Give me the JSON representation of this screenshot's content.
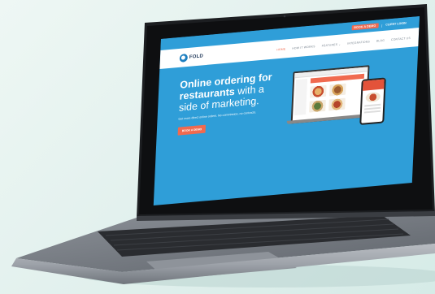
{
  "topbar": {
    "book_button": "BOOK A DEMO",
    "separator": "|",
    "login_link": "CLIENT LOGIN"
  },
  "navbar": {
    "logo_text": "FOLD",
    "links": [
      {
        "label": "HOME",
        "active": true
      },
      {
        "label": "HOW IT WORKS",
        "active": false
      },
      {
        "label": "FEATURES ⌄",
        "active": false
      },
      {
        "label": "INTEGRATIONS",
        "active": false
      },
      {
        "label": "BLOG",
        "active": false
      },
      {
        "label": "CONTACT US",
        "active": false
      }
    ]
  },
  "hero": {
    "line1": "Online ordering for",
    "line2_bold": "restaurants",
    "line2_rest": " with a",
    "line3": "side of marketing.",
    "subtitle": "Get more direct online orders. No commission, no contracts.",
    "cta": "BOOK A DEMO"
  },
  "colors": {
    "brand_blue": "#2f9ed8",
    "accent": "#f06a4f",
    "nav_text": "#7a8590",
    "background": "#e3f1ee"
  },
  "icons": [
    "logo-mark-icon",
    "laptop-mockup",
    "phone-mockup"
  ]
}
